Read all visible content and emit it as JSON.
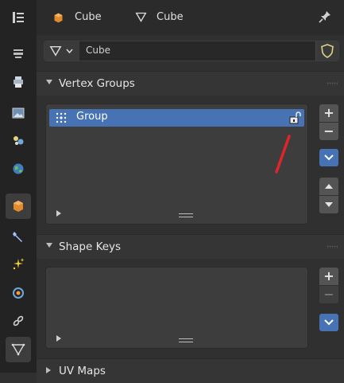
{
  "header": {
    "object_name": "Cube",
    "mesh_name": "Cube"
  },
  "datablock": {
    "name": "Cube"
  },
  "panels": {
    "vertex_groups": {
      "title": "Vertex Groups",
      "items": [
        {
          "label": "Group"
        }
      ],
      "buttons": {
        "add": "+",
        "remove": "−"
      }
    },
    "shape_keys": {
      "title": "Shape Keys",
      "buttons": {
        "add": "+",
        "remove": "−"
      }
    },
    "uv_maps": {
      "title": "UV Maps"
    }
  },
  "colors": {
    "accent": "#4772b3",
    "annotation": "#e0242b",
    "object_orange": "#e38a2a"
  }
}
